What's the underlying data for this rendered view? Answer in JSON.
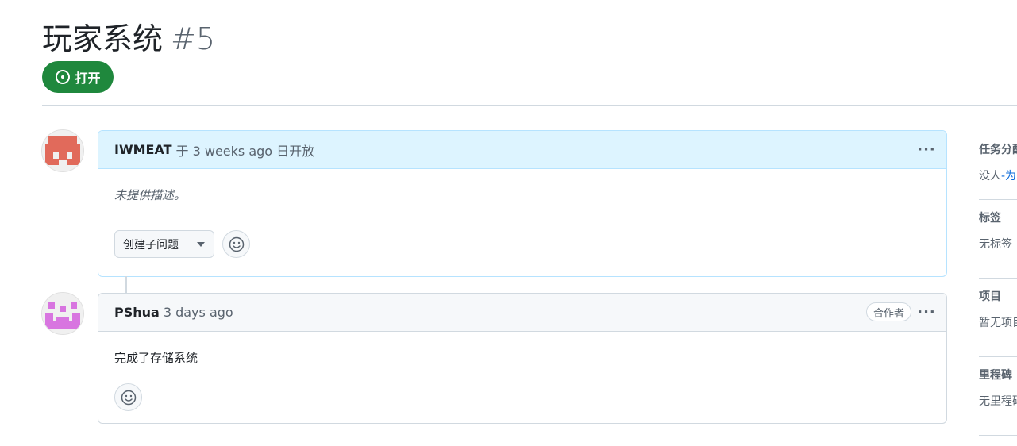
{
  "issue": {
    "title": "玩家系统",
    "number": "#5",
    "state": "打开"
  },
  "comments": [
    {
      "author": "IWMEAT",
      "meta": "于 3 weeks ago 日开放",
      "body": "未提供描述。",
      "create_subissue_label": "创建子问题"
    },
    {
      "author": "PShua",
      "meta": "3 days ago",
      "badge": "合作者",
      "body": "完成了存储系统"
    }
  ],
  "sidebar": {
    "assignees": {
      "title": "任务分配",
      "value": "没人",
      "link": "-为"
    },
    "labels": {
      "title": "标签",
      "value": "无标签"
    },
    "projects": {
      "title": "项目",
      "value": "暂无项目"
    },
    "milestone": {
      "title": "里程碑",
      "value": "无里程碑"
    }
  },
  "colors": {
    "open_green": "#1f883d",
    "author_header_bg": "#ddf4ff",
    "link_blue": "#0969da",
    "avatar1": "#e16a5b",
    "avatar2": "#d875e0"
  }
}
